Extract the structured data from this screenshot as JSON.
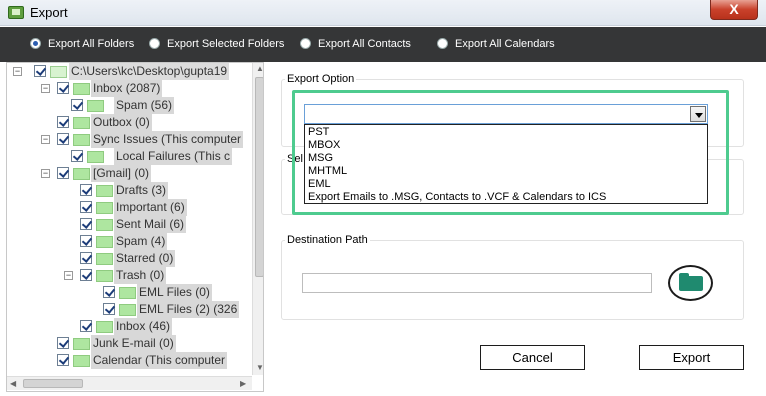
{
  "window": {
    "title": "Export",
    "close_label": "X"
  },
  "export_options": [
    {
      "label": "Export All Folders",
      "selected": true
    },
    {
      "label": "Export Selected Folders",
      "selected": false
    },
    {
      "label": "Export All Contacts",
      "selected": false
    },
    {
      "label": "Export All Calendars",
      "selected": false
    }
  ],
  "tree": [
    {
      "label": "C:\\Users\\kc\\Desktop\\gupta19",
      "checked": true
    },
    {
      "label": "Inbox (2087)",
      "checked": true
    },
    {
      "label": "Spam (56)",
      "checked": true
    },
    {
      "label": "Outbox (0)",
      "checked": true
    },
    {
      "label": "Sync Issues (This computer",
      "checked": true
    },
    {
      "label": "Local Failures (This c",
      "checked": true
    },
    {
      "label": "[Gmail] (0)",
      "checked": true
    },
    {
      "label": "Drafts (3)",
      "checked": true
    },
    {
      "label": "Important (6)",
      "checked": true
    },
    {
      "label": "Sent Mail (6)",
      "checked": true
    },
    {
      "label": "Spam (4)",
      "checked": true
    },
    {
      "label": "Starred (0)",
      "checked": true
    },
    {
      "label": "Trash (0)",
      "checked": true
    },
    {
      "label": "EML Files (0)",
      "checked": true
    },
    {
      "label": "EML Files (2) (326",
      "checked": true
    },
    {
      "label": "Inbox (46)",
      "checked": true
    },
    {
      "label": "Junk E-mail (0)",
      "checked": true
    },
    {
      "label": "Calendar (This computer",
      "checked": true
    }
  ],
  "export_option_group": {
    "label": "Export Option",
    "selected_value": "",
    "options": [
      "PST",
      "MBOX",
      "MSG",
      "MHTML",
      "EML",
      "Export Emails to .MSG, Contacts to .VCF & Calendars to ICS"
    ]
  },
  "hidden_group_label": "Sel",
  "destination": {
    "label": "Destination Path",
    "value": ""
  },
  "buttons": {
    "cancel": "Cancel",
    "export": "Export"
  },
  "colors": {
    "highlight": "#4ecb8f",
    "options_bar": "#353637",
    "folder_icon": "#1f8a6f"
  }
}
